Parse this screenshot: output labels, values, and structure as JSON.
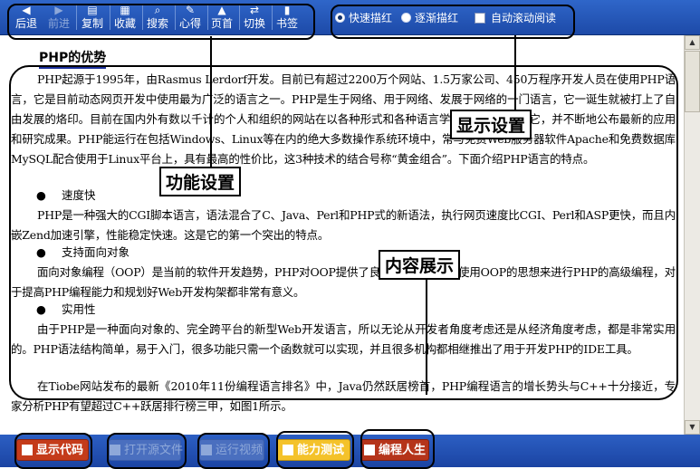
{
  "toolbar": {
    "buttons": [
      {
        "label": "后退",
        "icon": "back-arrow-icon",
        "glyph": "◀",
        "enabled": true
      },
      {
        "label": "前进",
        "icon": "forward-arrow-icon",
        "glyph": "▶",
        "enabled": false
      },
      {
        "label": "复制",
        "icon": "copy-icon",
        "glyph": "▤",
        "enabled": true
      },
      {
        "label": "收藏",
        "icon": "favorite-icon",
        "glyph": "▦",
        "enabled": true
      },
      {
        "label": "搜索",
        "icon": "search-icon",
        "glyph": "⌕",
        "enabled": true
      },
      {
        "label": "心得",
        "icon": "notes-icon",
        "glyph": "✎",
        "enabled": true
      },
      {
        "label": "页首",
        "icon": "page-top-icon",
        "glyph": "▲",
        "enabled": true
      },
      {
        "label": "切换",
        "icon": "switch-icon",
        "glyph": "⇄",
        "enabled": true
      },
      {
        "label": "书签",
        "icon": "bookmark-icon",
        "glyph": "▮",
        "enabled": true
      }
    ],
    "display_options": {
      "fast_highlight": "快速描红",
      "gradual_highlight": "逐渐描红",
      "auto_scroll": "自动滚动阅读",
      "selected": "fast_highlight"
    }
  },
  "content": {
    "title": "PHP的优势",
    "para1": "PHP起源于1995年，由Rasmus Lerdorf开发。目前已有超过2200万个网站、1.5万家公司、450万程序开发人员在使用PHP语言，它是目前动态网页开发中使用最为广泛的语言之一。PHP是生于网络、用于网络、发展于网络的一门语言，它一诞生就被打上了自由发展的烙印。目前在国内外有数以千计的个人和组织的网站在以各种形式和各种语言学习、发展和完善它，并不断地公布最新的应用和研究成果。PHP能运行在包括Windows、Linux等在内的绝大多数操作系统环境中，常与免费Web服务器软件Apache和免费数据库MySQL配合使用于Linux平台上，具有最高的性价比，这3种技术的结合号称“黄金组合”。下面介绍PHP语言的特点。",
    "bullet1": "速度快",
    "para2": "PHP是一种强大的CGI脚本语言，语法混合了C、Java、Perl和PHP式的新语法，执行网页速度比CGI、Perl和ASP更快，而且内嵌Zend加速引擎，性能稳定快速。这是它的第一个突出的特点。",
    "bullet2": "支持面向对象",
    "para3": "面向对象编程（OOP）是当前的软件开发趋势，PHP对OOP提供了良好的支持。可以使用OOP的思想来进行PHP的高级编程，对于提高PHP编程能力和规划好Web开发构架都非常有意义。",
    "bullet3": "实用性",
    "para4": "由于PHP是一种面向对象的、完全跨平台的新型Web开发语言，所以无论从开发者角度考虑还是从经济角度考虑，都是非常实用的。PHP语法结构简单，易于入门，很多功能只需一个函数就可以实现，并且很多机构都相继推出了用于开发PHP的IDE工具。",
    "para5": "在Tiobe网站发布的最新《2010年11份编程语言排名》中，Java仍然跃居榜首，PHP编程语言的增长势头与C++十分接近，专家分析PHP有望超过C++跃居排行榜三甲，如图1所示。"
  },
  "bottom": {
    "show_code": "显示代码",
    "open_example": "打开源文件",
    "instant_test": "运行视频",
    "ability_test": "能力测试",
    "programming_life": "编程人生"
  },
  "annotations": {
    "display_settings": "显示设置",
    "function_settings": "功能设置",
    "content_display": "内容展示"
  },
  "colors": {
    "toolbar_bg": "#2258bc",
    "title_underline": "#1a2f9a",
    "show_code_bg": "#c43b1a",
    "ability_test_bg": "#f4c22a"
  }
}
